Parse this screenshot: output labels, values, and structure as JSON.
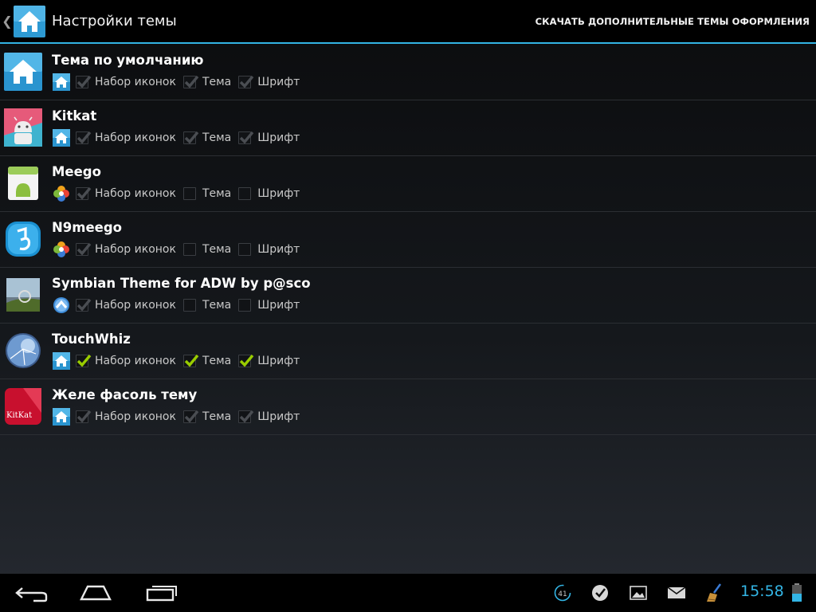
{
  "actionbar": {
    "title": "Настройки темы",
    "action": "СКАЧАТЬ ДОПОЛНИТЕЛЬНЫЕ ТЕМЫ ОФОРМЛЕНИЯ",
    "up_icon": "back-caret-icon",
    "app_icon": "home-icon"
  },
  "options": {
    "icons_label": "Набор иконок",
    "theme_label": "Тема",
    "font_label": "Шрифт"
  },
  "themes": [
    {
      "name": "Тема по умолчанию",
      "icon": "home-icon",
      "pack_icon": "home-icon",
      "icons": true,
      "theme": true,
      "font": true,
      "enabled": false
    },
    {
      "name": "Kitkat",
      "icon": "android-kitkat-icon",
      "pack_icon": "home-icon",
      "icons": true,
      "theme": true,
      "font": true,
      "enabled": false
    },
    {
      "name": "Meego",
      "icon": "meego-android-icon",
      "pack_icon": "clover-icon",
      "icons": true,
      "theme": false,
      "font": false,
      "enabled": false
    },
    {
      "name": "N9meego",
      "icon": "n9-icon",
      "pack_icon": "clover-icon",
      "icons": true,
      "theme": false,
      "font": false,
      "enabled": false
    },
    {
      "name": "Symbian Theme for ADW by p@sco",
      "icon": "symbian-icon",
      "pack_icon": "adw-icon",
      "icons": true,
      "theme": false,
      "font": false,
      "enabled": false
    },
    {
      "name": "TouchWhiz",
      "icon": "touchwhiz-icon",
      "pack_icon": "home-icon",
      "icons": true,
      "theme": true,
      "font": true,
      "enabled": true
    },
    {
      "name": "Желе фасоль тему",
      "icon": "kitkat-red-icon",
      "icon_text": "KitKat",
      "pack_icon": "home-icon",
      "icons": true,
      "theme": true,
      "font": true,
      "enabled": false
    }
  ],
  "statusbar": {
    "time": "15:58",
    "notification_count": "41",
    "accent": "#33b5e5",
    "check_active": "#99cc00"
  }
}
